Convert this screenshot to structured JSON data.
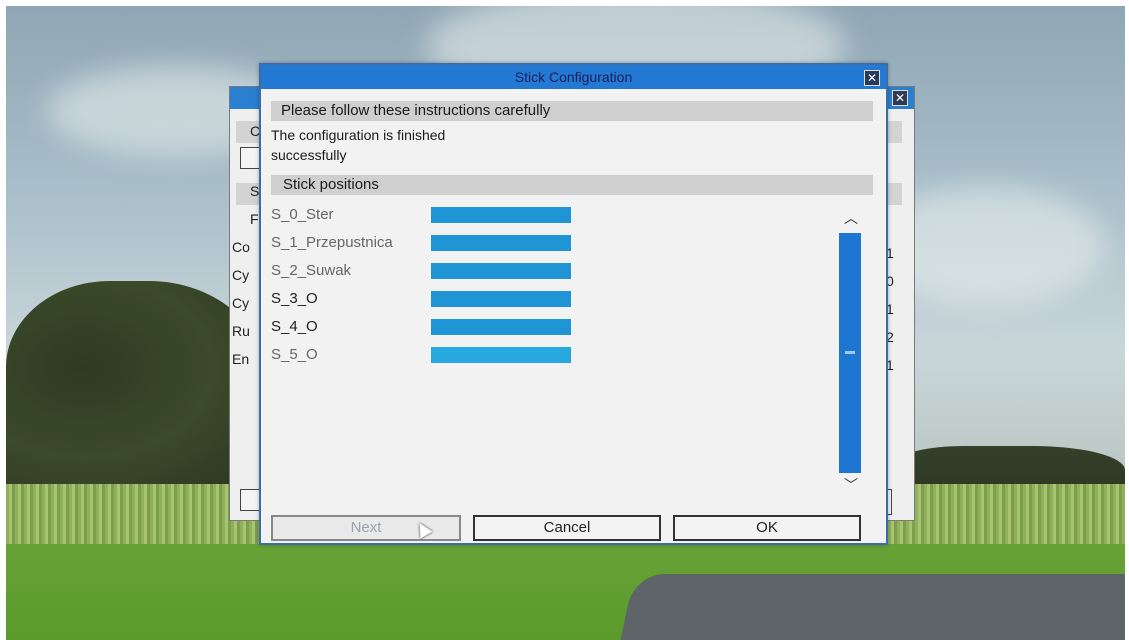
{
  "background_window": {
    "close_icon": "close-icon",
    "left_letters": [
      "C",
      "S",
      "F",
      "Co",
      "Cy",
      "Cy",
      "Ru",
      "En"
    ],
    "right_values": [
      "1",
      "0",
      "1",
      "2",
      "1"
    ]
  },
  "dialog": {
    "title": "Stick Configuration",
    "close_icon": "close-icon",
    "instructions_header": "Please follow these instructions carefully",
    "message_line1": "The configuration is finished",
    "message_line2": "successfully",
    "positions_header": "Stick positions",
    "sticks": [
      {
        "label": "S_0_Ster",
        "level": 1.0
      },
      {
        "label": "S_1_Przepustnica",
        "level": 1.0
      },
      {
        "label": "S_2_Suwak",
        "level": 1.0
      },
      {
        "label": "S_3_O",
        "level": 1.0
      },
      {
        "label": "S_4_O",
        "level": 1.0
      },
      {
        "label": "S_5_O",
        "level": 1.0
      }
    ],
    "scrollbar": {
      "up_icon": "chevron-up-icon",
      "down_icon": "chevron-down-icon"
    },
    "buttons": {
      "next": "Next",
      "cancel": "Cancel",
      "ok": "OK"
    }
  },
  "colors": {
    "titlebar": "#2379d3",
    "stick_bar": "#1f95d6",
    "scrollbar": "#1c76d2"
  }
}
